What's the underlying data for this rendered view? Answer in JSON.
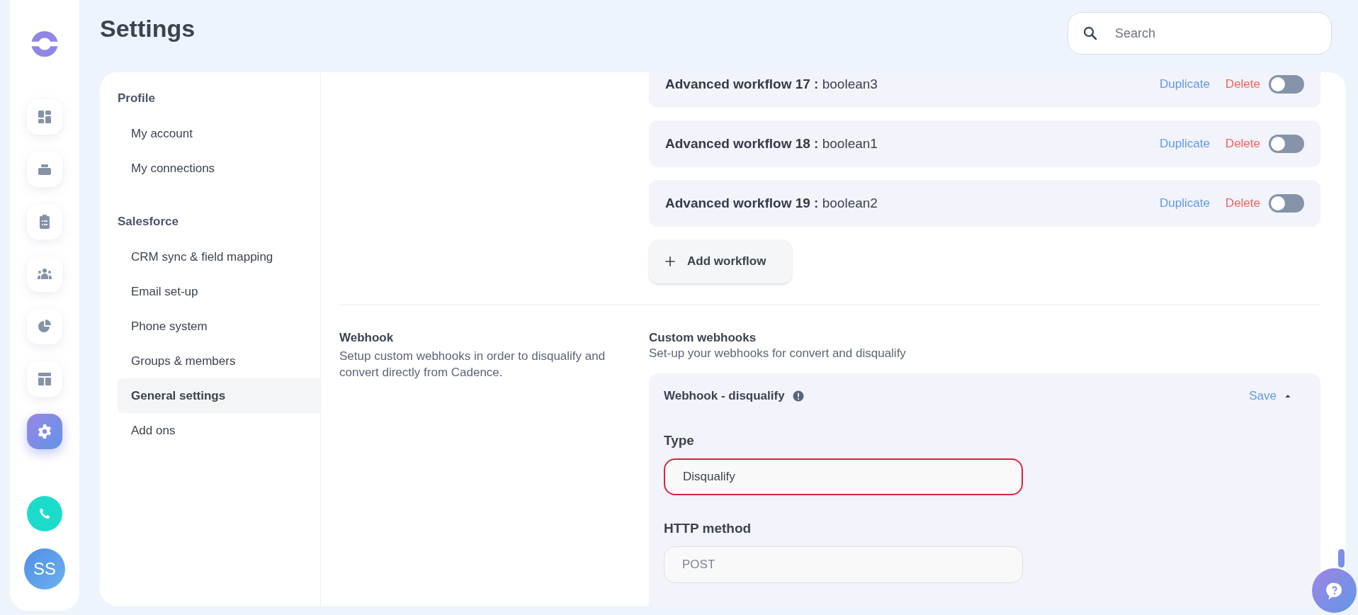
{
  "page_title": "Settings",
  "search": {
    "placeholder": "Search"
  },
  "rail": {
    "items": [
      {
        "kind": "dashboard",
        "selected": false
      },
      {
        "kind": "stack",
        "selected": false
      },
      {
        "kind": "clipboard",
        "selected": false
      },
      {
        "kind": "people",
        "selected": false
      },
      {
        "kind": "pie",
        "selected": false
      },
      {
        "kind": "layout",
        "selected": false
      },
      {
        "kind": "settings",
        "selected": true
      }
    ],
    "avatar": "SS"
  },
  "nav": {
    "groups": [
      {
        "title": "Profile",
        "items": [
          {
            "label": "My account",
            "selected": false
          },
          {
            "label": "My connections",
            "selected": false
          }
        ]
      },
      {
        "title": "Salesforce",
        "items": [
          {
            "label": "CRM sync & field mapping",
            "selected": false
          },
          {
            "label": "Email set-up",
            "selected": false
          },
          {
            "label": "Phone system",
            "selected": false
          },
          {
            "label": "Groups & members",
            "selected": false
          },
          {
            "label": "General settings",
            "selected": true
          },
          {
            "label": "Add ons",
            "selected": false
          }
        ]
      }
    ]
  },
  "workflows": {
    "items": [
      {
        "title": "**Advanced workflow 17 :** boolean3",
        "duplicate": "Duplicate",
        "delete": "Delete",
        "on": false
      },
      {
        "title": "**Advanced workflow 18 :** boolean1",
        "duplicate": "Duplicate",
        "delete": "Delete",
        "on": false
      },
      {
        "title": "**Advanced workflow 19 :** boolean2",
        "duplicate": "Duplicate",
        "delete": "Delete",
        "on": false
      }
    ],
    "add_button": "Add workflow"
  },
  "webhook": {
    "title": "Webhook",
    "description": "Setup custom webhooks in order to disqualify and convert directly from Cadence.",
    "custom_title": "Custom webhooks",
    "custom_description": "Set-up your webhooks for convert and disqualify",
    "card": {
      "title": "Webhook - disqualify",
      "save": "Save",
      "expanded": true,
      "fields": [
        {
          "label": "Type",
          "value": "Disqualify",
          "error": true,
          "disabled": false
        },
        {
          "label": "HTTP method",
          "value": "POST",
          "error": false,
          "disabled": true
        }
      ]
    }
  }
}
